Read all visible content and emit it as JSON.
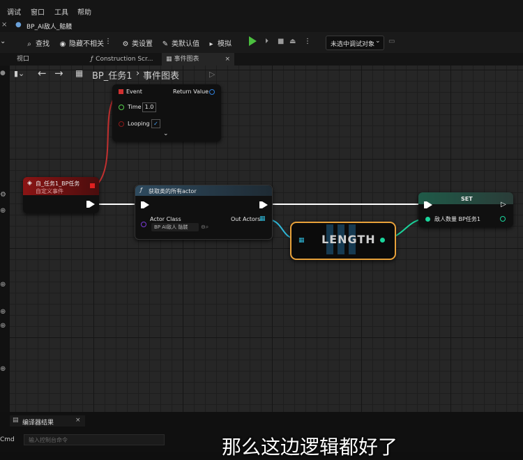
{
  "menu": {
    "items": [
      "调试",
      "窗口",
      "工具",
      "帮助"
    ]
  },
  "doc_tab": {
    "title": "BP_AI敌人_骷髅"
  },
  "toolbar": {
    "find": "查找",
    "hide_unrelated": "隐藏不相关",
    "class_settings": "类设置",
    "class_defaults": "类默认值",
    "simulate": "模拟",
    "debug_target": "未选中调试对象"
  },
  "panes": {
    "tabs": [
      "视口",
      "Construction Scr...",
      "事件图表"
    ]
  },
  "breadcrumb": {
    "root": "BP_任务1",
    "separator": "›",
    "current": "事件图表"
  },
  "nodes": {
    "timer": {
      "event": "Event",
      "return_value": "Return Value",
      "time_label": "Time",
      "time_value": "1.0",
      "looping_label": "Looping"
    },
    "custom_event": {
      "title": "自_任务1_BP任务",
      "subtitle": "自定义事件"
    },
    "get_all_actors": {
      "title": "获取类的所有actor",
      "actor_class_label": "Actor Class",
      "actor_class_value": "BP AI敌人 骷髅",
      "out_actors": "Out Actors"
    },
    "length": {
      "title": "LENGTH"
    },
    "set": {
      "title": "SET",
      "variable": "敌人数量 BP任务1"
    }
  },
  "bottom": {
    "compiler_results": "编译器结果",
    "cmd_label": "Cmd",
    "cmd_placeholder": "输入控制台命令"
  },
  "subtitle": "那么这边逻辑都好了",
  "colors": {
    "exec": "#ffffff",
    "array_pin": "#2fb8d8",
    "int_pin": "#1ad59c",
    "event_head": "#8a1414",
    "function_head": "#2e4a5e",
    "length_border": "#e8a13a",
    "set_head": "#1f5a48",
    "play": "#4bbf3f"
  }
}
